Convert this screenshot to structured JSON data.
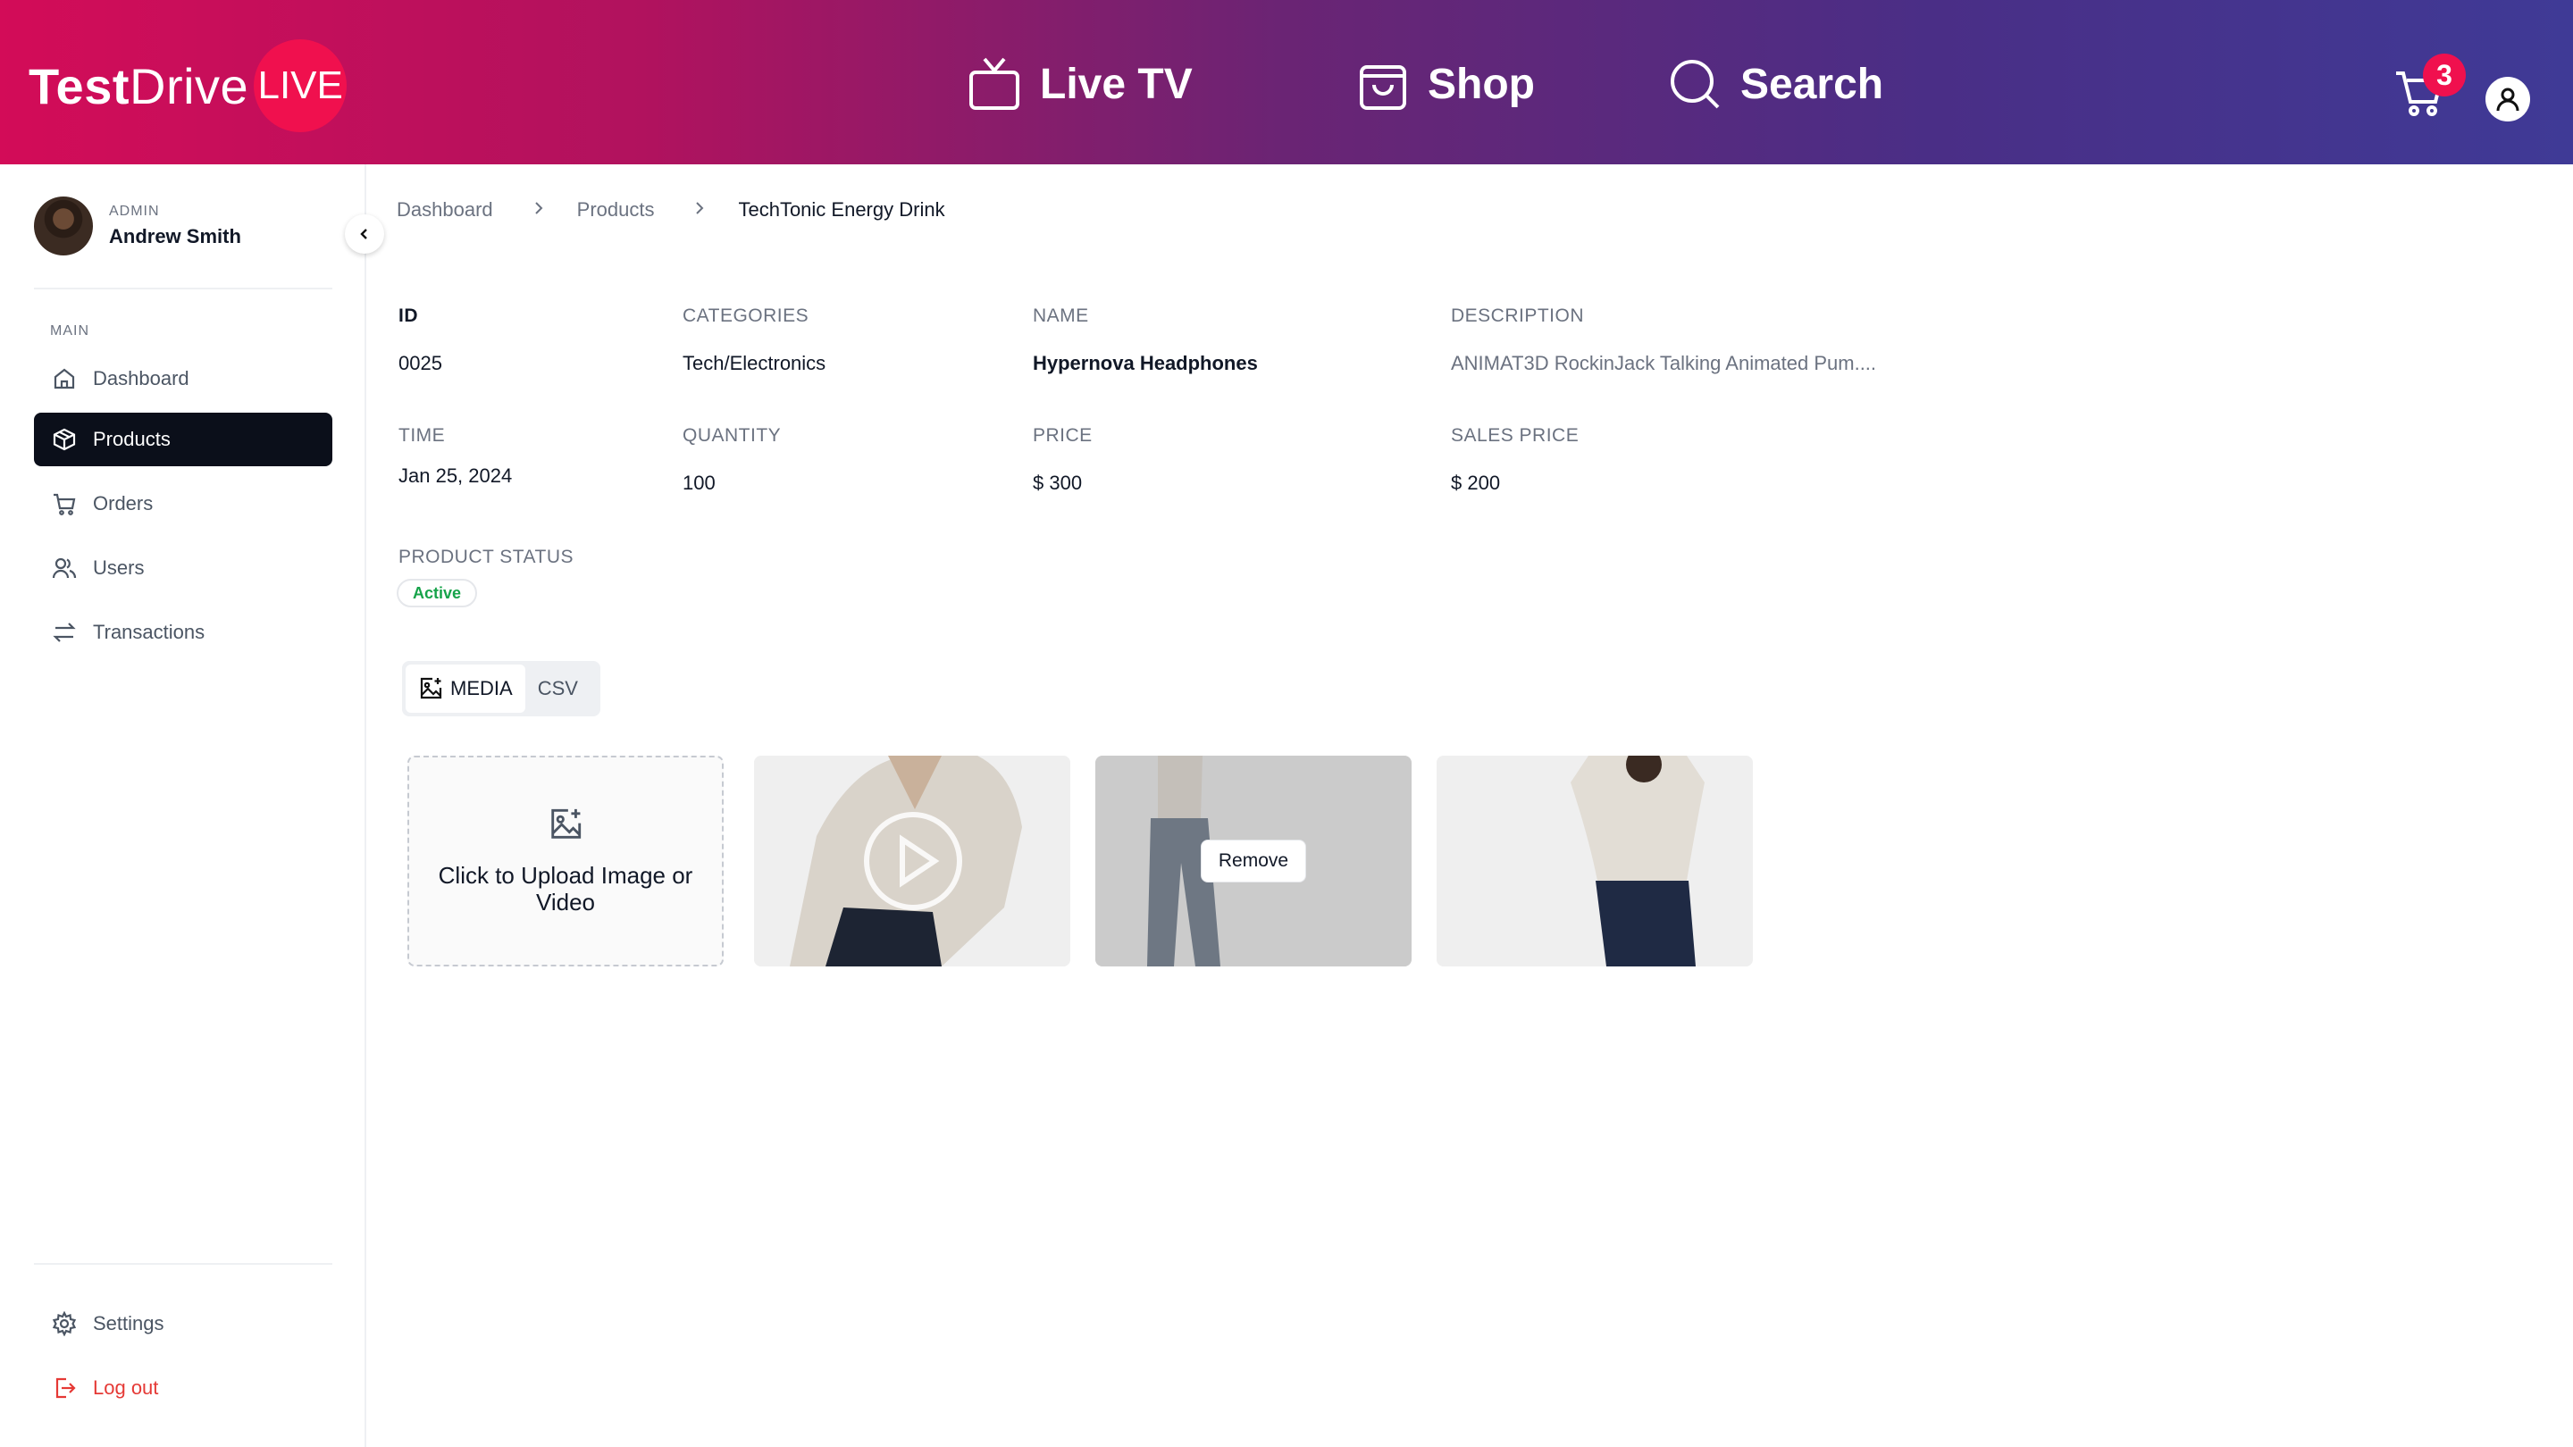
{
  "header": {
    "logo_test": "Test",
    "logo_drive": "Drive",
    "logo_live": "LIVE",
    "nav": {
      "live_tv": "Live TV",
      "shop": "Shop",
      "search": "Search"
    },
    "cart_count": "3",
    "colors": {
      "accent": "#f0104e",
      "gradient_start": "#d30c58",
      "gradient_end": "#3f3a96"
    }
  },
  "sidebar": {
    "profile": {
      "role": "ADMIN",
      "name": "Andrew Smith"
    },
    "section_label": "MAIN",
    "items": [
      {
        "label": "Dashboard",
        "icon": "home-icon"
      },
      {
        "label": "Products",
        "icon": "box-icon",
        "active": true
      },
      {
        "label": "Orders",
        "icon": "cart-icon"
      },
      {
        "label": "Users",
        "icon": "users-icon"
      },
      {
        "label": "Transactions",
        "icon": "arrows-icon"
      }
    ],
    "settings_label": "Settings",
    "logout_label": "Log out"
  },
  "breadcrumb": {
    "items": [
      "Dashboard",
      "Products"
    ],
    "current": "TechTonic Energy Drink"
  },
  "product": {
    "id_label": "ID",
    "id_value": "0025",
    "categories_label": "CATEGORIES",
    "categories_value": "Tech/Electronics",
    "name_label": "NAME",
    "name_value": "Hypernova Headphones",
    "description_label": "DESCRIPTION",
    "description_value": "ANIMAT3D RockinJack Talking Animated Pum....",
    "time_label": "TIME",
    "time_value": "Jan 25, 2024",
    "quantity_label": "QUANTITY",
    "quantity_value": "100",
    "price_label": "PRICE",
    "price_value": "$ 300",
    "sales_price_label": "SALES PRICE",
    "sales_price_value": "$ 200",
    "status_label": "PRODUCT STATUS",
    "status_value": "Active"
  },
  "tabs": {
    "media": "MEDIA",
    "csv": "CSV"
  },
  "media": {
    "upload_text": "Click to Upload Image or Video",
    "remove_label": "Remove"
  }
}
